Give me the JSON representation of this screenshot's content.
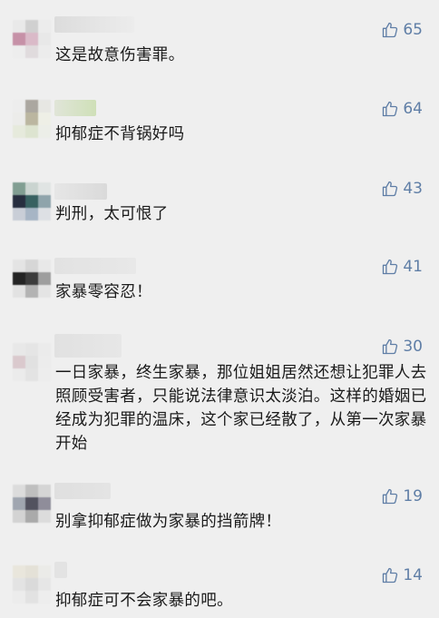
{
  "comments": [
    {
      "text": "这是故意伤害罪。",
      "likes": "65"
    },
    {
      "text": "抑郁症不背锅好吗",
      "likes": "64"
    },
    {
      "text": "判刑，太可恨了",
      "likes": "43"
    },
    {
      "text": "家暴零容忍！",
      "likes": "41"
    },
    {
      "text": "一日家暴，终生家暴，那位姐姐居然还想让犯罪人去照顾受害者，只能说法律意识太淡泊。这样的婚姻已经成为犯罪的温床，这个家已经散了，从第一次家暴开始",
      "likes": "30"
    },
    {
      "text": "别拿抑郁症做为家暴的挡箭牌！",
      "likes": "19"
    },
    {
      "text": "抑郁症可不会家暴的吧。",
      "likes": "14"
    }
  ],
  "like_icon": "thumbs-up-icon",
  "colors": {
    "background": "#efefef",
    "like": "#5f7ea6",
    "text": "#1a1a1a"
  }
}
